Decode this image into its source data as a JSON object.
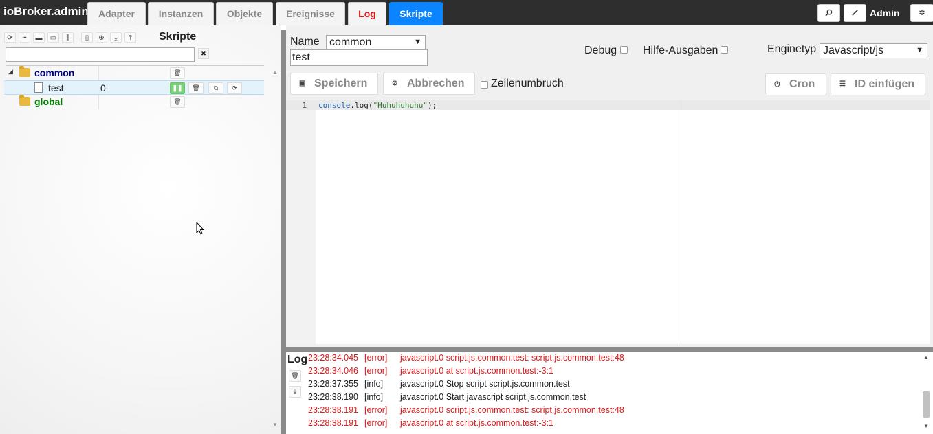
{
  "app": {
    "title": "ioBroker.admin"
  },
  "nav": {
    "tabs": [
      {
        "label": "Adapter"
      },
      {
        "label": "Instanzen"
      },
      {
        "label": "Objekte"
      },
      {
        "label": "Ereignisse"
      },
      {
        "label": "Log"
      },
      {
        "label": "Skripte"
      }
    ],
    "active_tab": "Skripte",
    "user_label": "Admin"
  },
  "sidebar": {
    "title": "Skripte",
    "filter_value": "",
    "toolbar_icons": [
      "refresh-icon",
      "collapse-icon",
      "folder-closed-icon",
      "folder-open-icon",
      "columns-icon",
      "new-file-icon",
      "add-circle-icon",
      "import-icon",
      "export-icon"
    ],
    "tree": [
      {
        "type": "folder",
        "label": "common",
        "expanded": true,
        "color": "#000080"
      },
      {
        "type": "script",
        "label": "test",
        "value": "0",
        "selected": true
      },
      {
        "type": "folder",
        "label": "global",
        "expanded": false,
        "color": "#008000"
      }
    ]
  },
  "editor_form": {
    "name_label": "Name",
    "group_value": "common",
    "name_value": "test",
    "debug_label": "Debug",
    "debug_checked": false,
    "hilfe_label": "Hilfe-Ausgaben",
    "hilfe_checked": false,
    "enginetyp_label": "Enginetyp",
    "enginetyp_value": "Javascript/js",
    "save_label": "Speichern",
    "cancel_label": "Abbrechen",
    "wrap_label": "Zeilenumbruch",
    "wrap_checked": false,
    "cron_label": "Cron",
    "id_insert_label": "ID einfügen"
  },
  "code": {
    "lines": [
      {
        "number": "1",
        "keyword": "console",
        "rest_before": ".log(",
        "string": "\"Huhuhuhuhu\"",
        "rest_after": ");"
      }
    ]
  },
  "log": {
    "title": "Log",
    "entries": [
      {
        "time": "23:28:34.045",
        "level": "[error]",
        "message": "javascript.0 script.js.common.test: script.js.common.test:48"
      },
      {
        "time": "23:28:34.046",
        "level": "[error]",
        "message": "javascript.0 at script.js.common.test:-3:1"
      },
      {
        "time": "23:28:37.355",
        "level": "[info]",
        "message": "javascript.0 Stop script script.js.common.test"
      },
      {
        "time": "23:28:38.190",
        "level": "[info]",
        "message": "javascript.0 Start javascript script.js.common.test"
      },
      {
        "time": "23:28:38.191",
        "level": "[error]",
        "message": "javascript.0 script.js.common.test: script.js.common.test:48"
      },
      {
        "time": "23:28:38.191",
        "level": "[error]",
        "message": "javascript.0 at script.js.common.test:-3:1"
      }
    ]
  },
  "colors": {
    "active_tab": "#0a84ff",
    "log_tab": "#e0191b",
    "error": "#e0191b",
    "running": "#7bd37b"
  }
}
